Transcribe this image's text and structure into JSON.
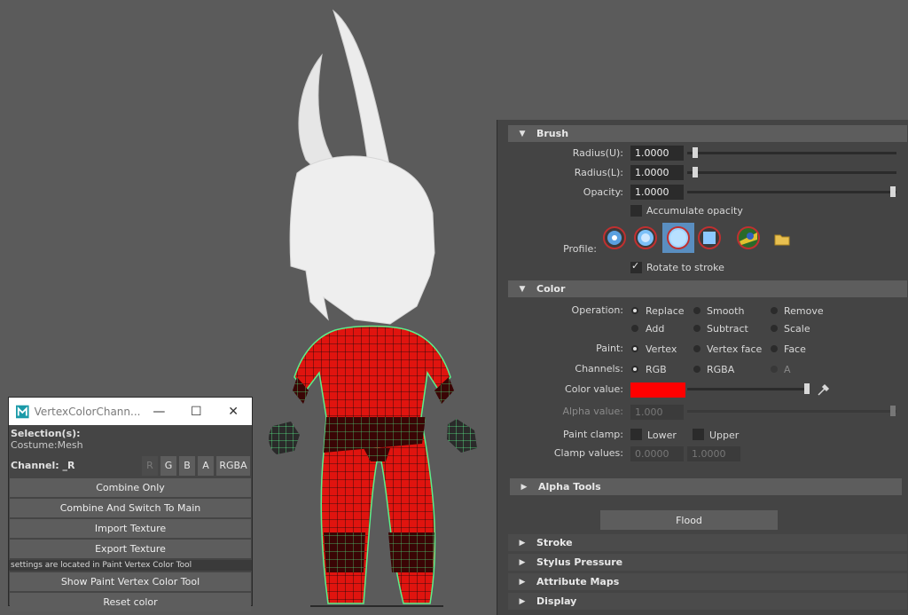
{
  "tool_window": {
    "title": "VertexColorChann...",
    "minimize_icon": "minimize-icon",
    "maximize_icon": "maximize-icon",
    "close_icon": "close-icon",
    "selection_label": "Selection(s):",
    "selection_value": "Costume:Mesh",
    "channel_label": "Channel: _R",
    "channel_buttons": [
      "R",
      "G",
      "B",
      "A",
      "RGBA"
    ],
    "combine_only": "Combine Only",
    "combine_switch": "Combine And Switch To Main",
    "import_texture": "Import Texture",
    "export_texture": "Export Texture",
    "note": "settings are located in Paint Vertex Color Tool",
    "show_tool": "Show Paint Vertex Color Tool",
    "reset_color": "Reset color"
  },
  "panel": {
    "brush": {
      "header": "Brush",
      "radius_u_label": "Radius(U):",
      "radius_u_value": "1.0000",
      "radius_l_label": "Radius(L):",
      "radius_l_value": "1.0000",
      "opacity_label": "Opacity:",
      "opacity_value": "1.0000",
      "accumulate_label": "Accumulate opacity",
      "accumulate_checked": false,
      "profile_label": "Profile:",
      "profile_selected": "soft-round",
      "folder_icon": "folder-icon",
      "rotate_label": "Rotate to stroke",
      "rotate_checked": true
    },
    "color": {
      "header": "Color",
      "operation_label": "Operation:",
      "operations": [
        "Replace",
        "Smooth",
        "Remove",
        "Add",
        "Subtract",
        "Scale"
      ],
      "operation_selected": "Replace",
      "paint_label": "Paint:",
      "paint_options": [
        "Vertex",
        "Vertex face",
        "Face"
      ],
      "paint_selected": "Vertex",
      "channels_label": "Channels:",
      "channel_options": [
        "RGB",
        "RGBA",
        "A"
      ],
      "channel_selected": "RGB",
      "color_value_label": "Color value:",
      "color_value": "#ff0000",
      "alpha_value_label": "Alpha value:",
      "alpha_value": "1.000",
      "paint_clamp_label": "Paint clamp:",
      "clamp_lower": "Lower",
      "clamp_upper": "Upper",
      "clamp_values_label": "Clamp values:",
      "clamp_low_value": "0.0000",
      "clamp_high_value": "1.0000"
    },
    "alpha_tools": "Alpha Tools",
    "flood": "Flood",
    "stroke": "Stroke",
    "stylus_pressure": "Stylus Pressure",
    "attribute_maps": "Attribute Maps",
    "display": "Display"
  }
}
